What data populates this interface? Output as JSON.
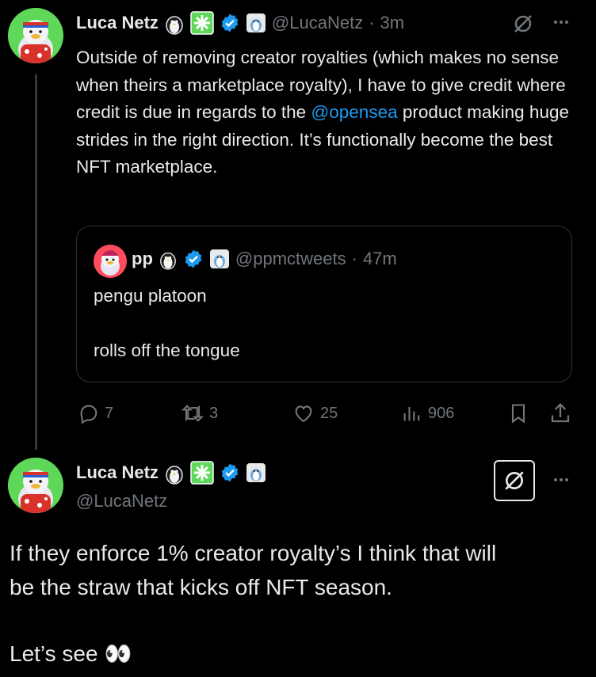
{
  "tweet": {
    "author_name": "Luca Netz",
    "handle": "@LucaNetz",
    "separator": "·",
    "time": "3m",
    "body_before_mention": "Outside of removing creator royalties (which makes no sense when theirs a marketplace royalty), I have to give credit where credit is due in regards to the ",
    "mention": "@opensea",
    "body_after_mention": " product making huge strides in the right direction. It’s functionally become the best NFT marketplace.",
    "quote": {
      "author_name": "pp",
      "handle": "@ppmctweets",
      "separator": "·",
      "time": "47m",
      "line1": "pengu platoon",
      "line2": "rolls off the tongue"
    },
    "actions": {
      "replies": "7",
      "reposts": "3",
      "likes": "25",
      "views": "906"
    }
  },
  "reply": {
    "author_name": "Luca Netz",
    "handle": "@LucaNetz",
    "line1": "If they enforce 1% creator royalty’s I think that will",
    "line2": "be the straw that kicks off NFT season.",
    "line3": "Let’s see",
    "emoji": "👀"
  },
  "icons": {
    "more": "more-icon",
    "grok": "grok-icon",
    "verified": "verified-badge-icon",
    "reply": "reply-icon",
    "repost": "repost-icon",
    "like": "like-icon",
    "views": "views-icon",
    "bookmark": "bookmark-icon",
    "share": "share-icon"
  },
  "colors": {
    "background": "#000000",
    "text": "#e7e9ea",
    "muted": "#71767b",
    "accent": "#1d9bf0",
    "avatar_bg": "#5fd85a"
  }
}
